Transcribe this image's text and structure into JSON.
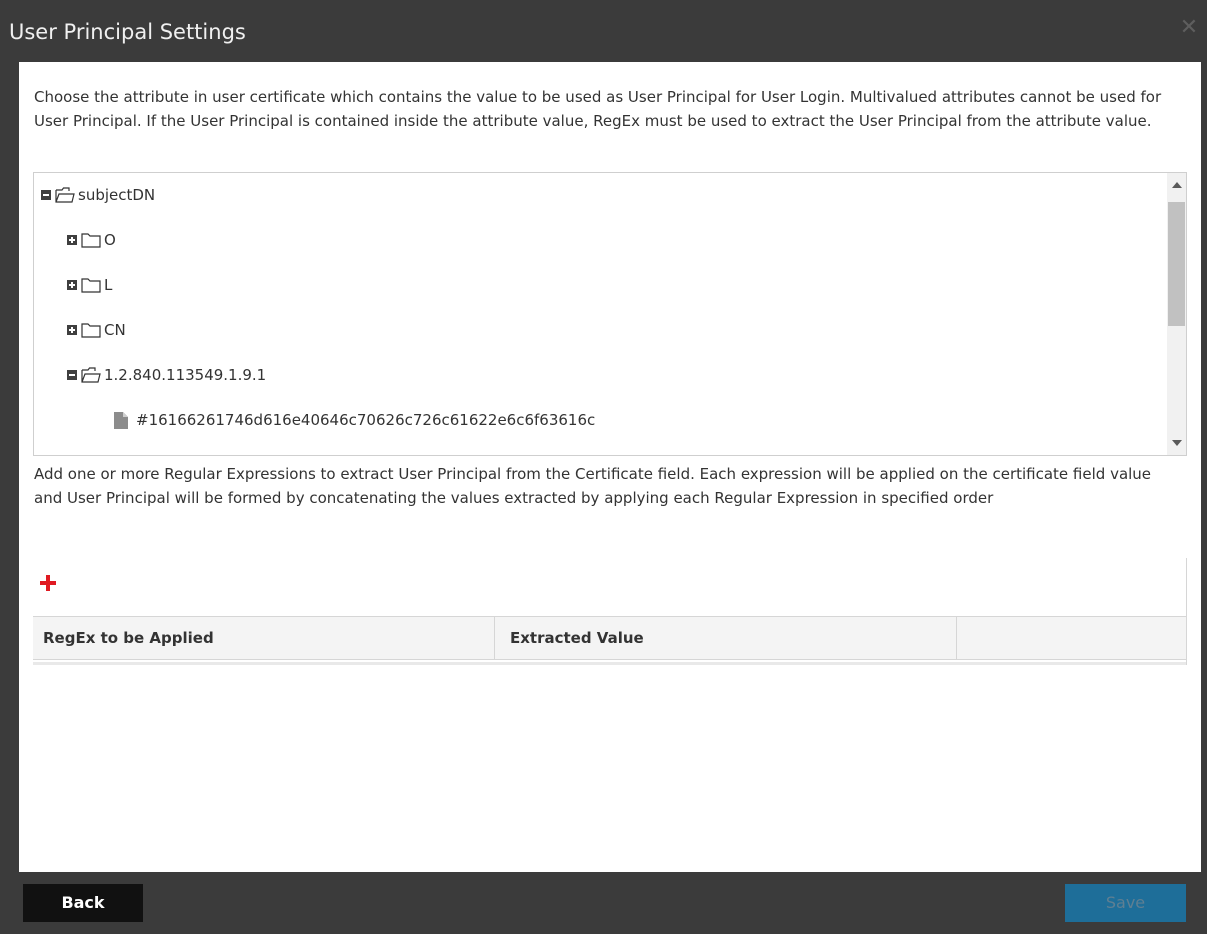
{
  "dialog": {
    "title": "User Principal Settings",
    "close_icon": "close-icon",
    "close_glyph": "✕"
  },
  "attribute_section": {
    "description": "Choose the attribute in user certificate which contains the value to be used as User Principal for User Login. Multivalued attributes cannot be used for User Principal. If the User Principal is contained inside the attribute value, RegEx must be used to extract the User Principal from the attribute value."
  },
  "tree": {
    "nodes": [
      {
        "label": "subjectDN",
        "state": "expanded",
        "type": "folder"
      },
      {
        "label": "O",
        "state": "collapsed",
        "type": "folder"
      },
      {
        "label": "L",
        "state": "collapsed",
        "type": "folder"
      },
      {
        "label": "CN",
        "state": "collapsed",
        "type": "folder"
      },
      {
        "label": "1.2.840.113549.1.9.1",
        "state": "expanded",
        "type": "folder"
      },
      {
        "label": "#16166261746d616e40646c70626c726c61622e6c6f63616c",
        "state": "leaf",
        "type": "file"
      }
    ]
  },
  "regex_section": {
    "description": "Add one or more Regular Expressions to extract User Principal from the Certificate field. Each expression will be applied on the certificate field value and User Principal will be formed by concatenating the values extracted by applying each Regular Expression in specified order",
    "add_icon": "plus-icon",
    "columns": [
      "RegEx to be Applied",
      "Extracted Value",
      ""
    ]
  },
  "footer": {
    "back_label": "Back",
    "save_label": "Save"
  },
  "colors": {
    "titlebar": "#3b3b3b",
    "accent_add": "#e01a22",
    "save_button": "#1e6e99",
    "back_button": "#111111"
  }
}
